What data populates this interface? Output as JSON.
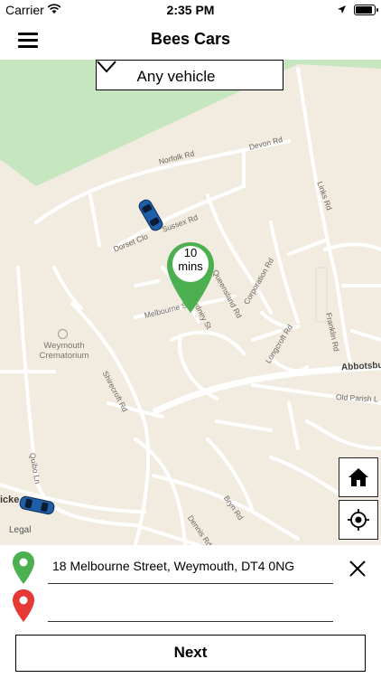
{
  "status": {
    "carrier": "Carrier",
    "time": "2:35 PM"
  },
  "nav": {
    "title": "Bees Cars"
  },
  "vehicle_filter": {
    "selected": "Any vehicle"
  },
  "pin": {
    "eta_value": "10",
    "eta_unit": "mins",
    "color": "#4caf50"
  },
  "map": {
    "streets": {
      "norfolk": "Norfolk Rd",
      "devon": "Devon Rd",
      "links": "Links Rd",
      "dorset": "Dorset Clo",
      "sussex": "Sussex Rd",
      "queensland": "Queensland Rd",
      "corporation": "Corporation Rd",
      "franklin": "Franklin Rd",
      "melbourne": "Melbourne St",
      "sydney": "Sydney St",
      "longcroft": "Longcroft Rd",
      "shirecroft": "Shirecroft Rd",
      "abbotsbury": "Abbotsbu",
      "old_parish": "Old Parish L",
      "quibo": "Quibo Ln",
      "bryn": "Bryn Rd",
      "dennis": "Dennis Rd",
      "icke": "icke"
    },
    "poi": {
      "line1": "Weymouth",
      "line2": "Crematorium"
    },
    "legal": "Legal"
  },
  "booking": {
    "pickup_address": "18 Melbourne Street, Weymouth, DT4 0NG",
    "dropoff_address": "",
    "next_label": "Next",
    "pickup_marker_color": "#4caf50",
    "dropoff_marker_color": "#e53935"
  }
}
